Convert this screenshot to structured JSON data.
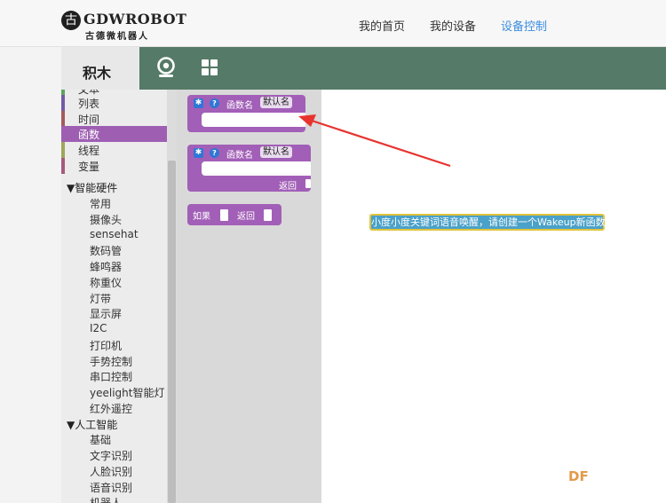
{
  "header": {
    "logo_mark": "古",
    "logo_title": "GDWROBOT",
    "logo_subtitle": "古德微机器人",
    "nav": [
      {
        "label": "我的首页",
        "active": false
      },
      {
        "label": "我的设备",
        "active": false
      },
      {
        "label": "设备控制",
        "active": true
      }
    ]
  },
  "toolbar": {
    "tab_label": "积木",
    "icons": [
      "webcam-icon",
      "grid-icon"
    ]
  },
  "colors": {
    "header_green": "#557a67",
    "function_block": "#a25fb7",
    "nav_active": "#3d8ee0",
    "hint_bg": "#4aa1c9",
    "hint_border": "#e1c43b",
    "arrow": "#e8332f"
  },
  "sidebar": {
    "categories": [
      {
        "label": "文本",
        "color": "#5ba55b"
      },
      {
        "label": "列表",
        "color": "#745ba5"
      },
      {
        "label": "时间",
        "color": "#a55b5b"
      },
      {
        "label": "函数",
        "color": "#9e5fb3",
        "selected": true
      },
      {
        "label": "线程",
        "color": "#9fa55b"
      },
      {
        "label": "变量",
        "color": "#a55b80"
      }
    ],
    "group_hardware": "▼智能硬件",
    "hardware_items": [
      "常用",
      "摄像头",
      "sensehat",
      "数码管",
      "蜂鸣器",
      "称重仪",
      "灯带",
      "显示屏",
      "I2C",
      "打印机",
      "手势控制",
      "串口控制",
      "yeelight智能灯",
      "红外遥控"
    ],
    "group_ai": "▼人工智能",
    "ai_items": [
      "基础",
      "文字识别",
      "人脸识别",
      "语音识别",
      "机器人"
    ]
  },
  "flyout": {
    "block1": {
      "label": "函数名",
      "field": "默认名"
    },
    "block2": {
      "label": "函数名",
      "field": "默认名",
      "return_label": "返回"
    },
    "block3": {
      "if_label": "如果",
      "return_label": "返回"
    }
  },
  "workspace": {
    "hint": "小度小度关键词语音唤醒，请创建一个Wakeup新函数"
  },
  "watermark": "DF"
}
